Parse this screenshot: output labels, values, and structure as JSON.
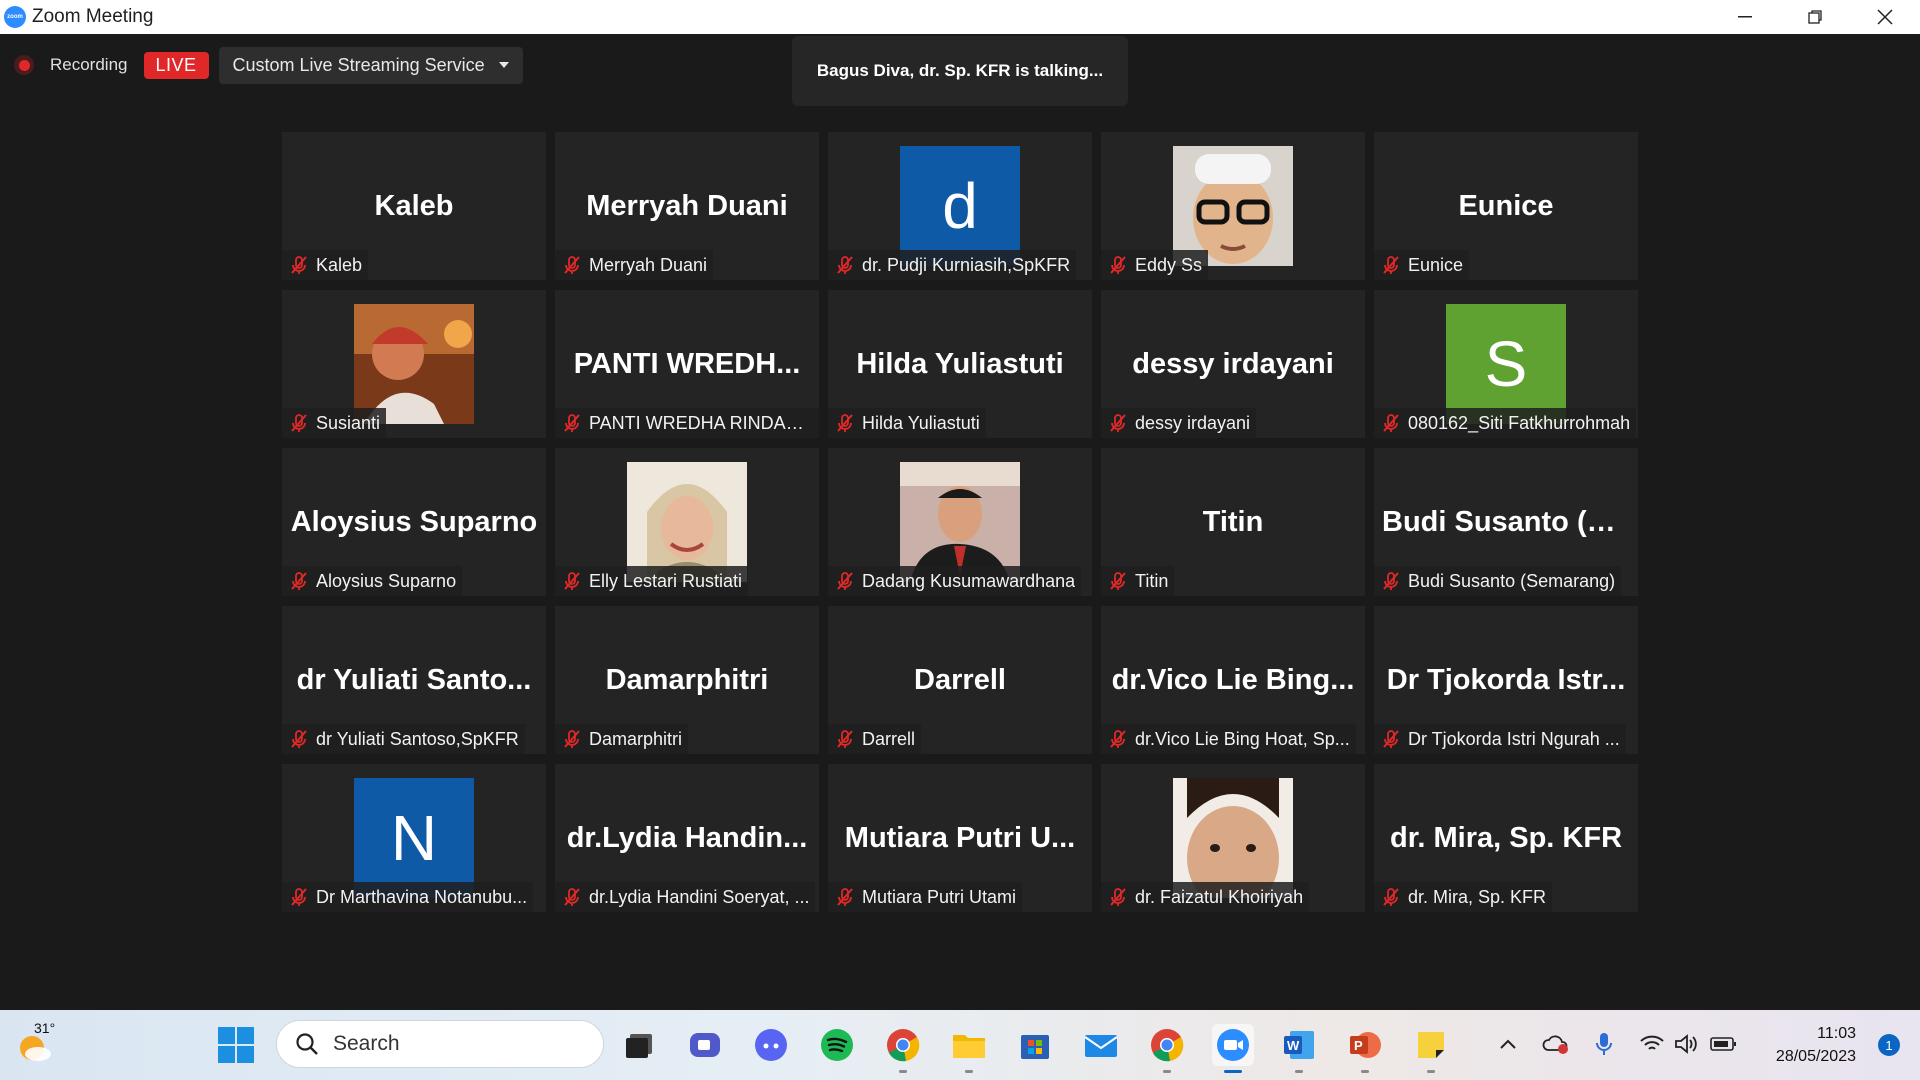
{
  "window": {
    "title": "Zoom Meeting"
  },
  "recording": {
    "label": "Recording",
    "live_badge": "LIVE",
    "stream_service": "Custom Live Streaming Service"
  },
  "talking_banner": "Bagus Diva, dr. Sp. KFR is talking...",
  "participants": [
    {
      "big": "Kaleb",
      "name": "Kaleb",
      "muted": true
    },
    {
      "big": "Merryah Duani",
      "name": "Merryah Duani",
      "muted": true
    },
    {
      "avatar_letter": "d",
      "avatar_color": "#0e5aa7",
      "name": "dr. Pudji Kurniasih,SpKFR",
      "muted": true
    },
    {
      "photo": "man-with-glasses",
      "name": "Eddy Ss",
      "muted": true
    },
    {
      "big": "Eunice",
      "name": "Eunice",
      "muted": true
    },
    {
      "photo": "woman-red-scarf",
      "name": "Susianti",
      "muted": true
    },
    {
      "big": "PANTI WREDH...",
      "name": "PANTI WREDHA RINDAN...",
      "muted": true
    },
    {
      "big": "Hilda Yuliastuti",
      "name": "Hilda Yuliastuti",
      "muted": true
    },
    {
      "big": "dessy irdayani",
      "name": "dessy irdayani",
      "muted": true
    },
    {
      "avatar_letter": "S",
      "avatar_color": "#5fa232",
      "name": "080162_Siti Fatkhurrohmah",
      "muted": true
    },
    {
      "big": "Aloysius Suparno",
      "name": "Aloysius Suparno",
      "muted": true
    },
    {
      "photo": "woman-hijab",
      "name": "Elly Lestari Rustiati",
      "muted": true
    },
    {
      "photo": "man-suit",
      "name": "Dadang Kusumawardhana",
      "muted": true
    },
    {
      "big": "Titin",
      "name": "Titin",
      "muted": true
    },
    {
      "big": "Budi Susanto (S...",
      "name": "Budi Susanto (Semarang)",
      "muted": true
    },
    {
      "big": "dr Yuliati Santo...",
      "name": "dr Yuliati Santoso,SpKFR",
      "muted": true
    },
    {
      "big": "Damarphitri",
      "name": "Damarphitri",
      "muted": true
    },
    {
      "big": "Darrell",
      "name": "Darrell",
      "muted": true
    },
    {
      "big": "dr.Vico Lie Bing...",
      "name": "dr.Vico Lie Bing Hoat, Sp...",
      "muted": true
    },
    {
      "big": "Dr Tjokorda Istr...",
      "name": "Dr Tjokorda Istri Ngurah ...",
      "muted": true
    },
    {
      "avatar_letter": "N",
      "avatar_color": "#0e5aa7",
      "name": "Dr Marthavina Notanubu...",
      "muted": true
    },
    {
      "big": "dr.Lydia Handin...",
      "name": "dr.Lydia Handini Soeryat, ...",
      "muted": true
    },
    {
      "big": "Mutiara Putri U...",
      "name": "Mutiara Putri Utami",
      "muted": true
    },
    {
      "photo": "child-face",
      "name": "dr. Faizatul Khoiriyah",
      "muted": true
    },
    {
      "big": "dr. Mira, Sp. KFR",
      "name": "dr. Mira, Sp. KFR",
      "muted": true
    }
  ],
  "taskbar": {
    "weather_temp": "31°",
    "search_placeholder": "Search",
    "apps": [
      "task-view",
      "teams-chat",
      "discord",
      "spotify",
      "chrome",
      "file-explorer",
      "microsoft-store",
      "mail",
      "chrome-profile",
      "zoom",
      "word",
      "powerpoint",
      "sticky-notes"
    ],
    "time": "11:03",
    "date": "28/05/2023",
    "notifications": "1"
  }
}
